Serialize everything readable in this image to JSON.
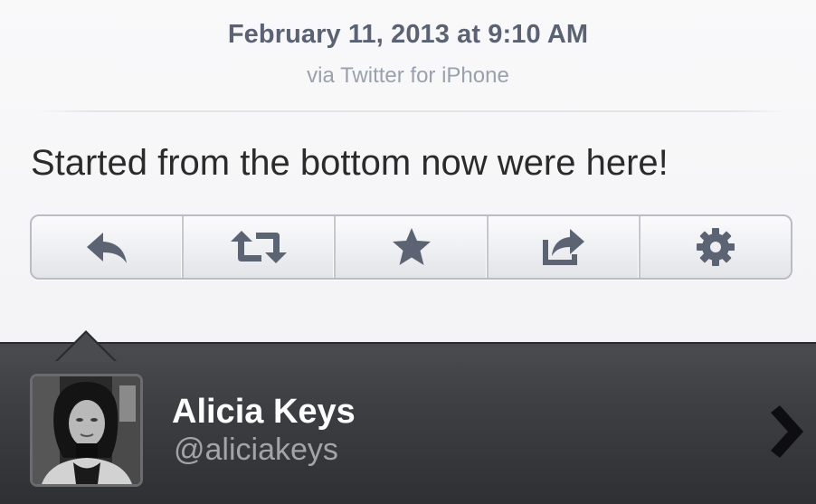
{
  "tweet": {
    "date": "February 11, 2013 at 9:10 AM",
    "source": "via Twitter for iPhone",
    "text": "Started from the bottom now were here!"
  },
  "actions": [
    {
      "id": "reply",
      "icon": "reply-icon"
    },
    {
      "id": "retweet",
      "icon": "retweet-icon"
    },
    {
      "id": "favorite",
      "icon": "star-icon"
    },
    {
      "id": "share",
      "icon": "share-icon"
    },
    {
      "id": "settings",
      "icon": "gear-icon"
    }
  ],
  "user": {
    "name": "Alicia Keys",
    "handle": "@aliciakeys",
    "avatar": "profile-photo",
    "disclosure_icon": "chevron-right-icon"
  },
  "colors": {
    "date_text": "#5a6273",
    "source_text": "#9aa1ad",
    "tweet_text": "#2b2b2b",
    "icon": "#5c6373",
    "user_bar": "#3c3d41",
    "handle_text": "#a2a4a9"
  }
}
